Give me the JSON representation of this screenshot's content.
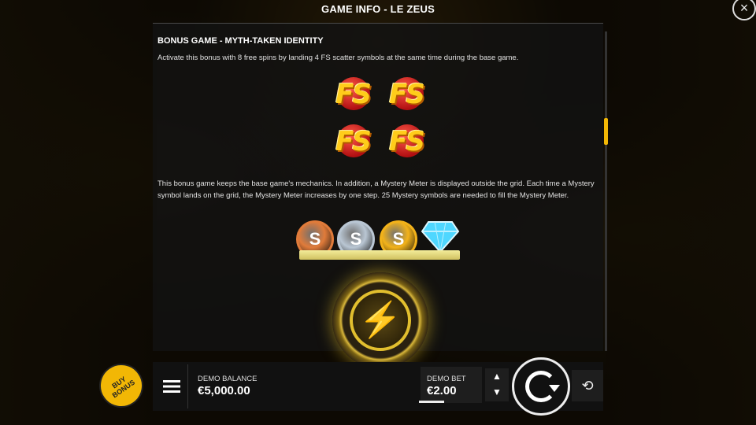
{
  "header": {
    "title": "GAME INFO - LE ZEUS",
    "close_icon": "×"
  },
  "section": {
    "heading": "BONUS GAME - MYTH-TAKEN IDENTITY",
    "intro": "Activate this bonus with 8 free spins by landing 4 FS scatter symbols at the same time during the base game.",
    "fs_symbol_text": "FS",
    "mechanics": "This bonus game keeps the base game's mechanics. In addition, a Mystery Meter is displayed outside the grid. Each time a Mystery symbol lands on the grid, the Mystery Meter increases by one step. 25 Mystery symbols are needed to fill the Mystery Meter."
  },
  "meter": {
    "coins": [
      {
        "label": "S",
        "color": "#e07b3a"
      },
      {
        "label": "S",
        "color": "#b9c6d3"
      },
      {
        "label": "S",
        "color": "#f2b21a"
      }
    ],
    "gem_color": "#4fd7ff",
    "bolt_icon": "⚡"
  },
  "bottom_bar": {
    "buy_bonus_label": "BUY BONUS",
    "balance_label": "DEMO BALANCE",
    "balance_value": "€5,000.00",
    "bet_label": "DEMO BET",
    "bet_value": "€2.00",
    "bet_up_icon": "▲",
    "bet_down_icon": "▼",
    "autoplay_icon": "⟲"
  },
  "colors": {
    "accent": "#f2b705",
    "panel": "#121212"
  }
}
